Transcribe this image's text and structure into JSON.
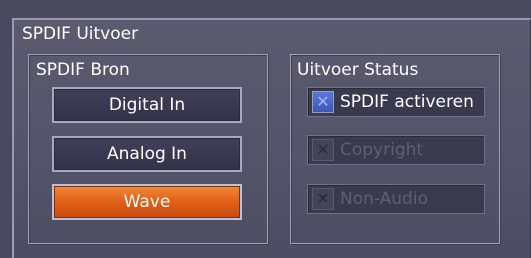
{
  "panel": {
    "title": "SPDIF Uitvoer"
  },
  "source_group": {
    "title": "SPDIF Bron",
    "buttons": [
      {
        "label": "Digital In",
        "selected": false
      },
      {
        "label": "Analog In",
        "selected": false
      },
      {
        "label": "Wave",
        "selected": true
      }
    ]
  },
  "status_group": {
    "title": "Uitvoer Status",
    "options": [
      {
        "label": "SPDIF activeren",
        "checked": true,
        "enabled": true
      },
      {
        "label": "Copyright",
        "checked": false,
        "enabled": false
      },
      {
        "label": "Non-Audio",
        "checked": false,
        "enabled": false
      }
    ]
  },
  "icons": {
    "checkbox_mark": "✕"
  },
  "colors": {
    "selected_button": "#e3621a",
    "checkbox_checked": "#3c58b8",
    "disabled_text": "#5e5e72"
  }
}
